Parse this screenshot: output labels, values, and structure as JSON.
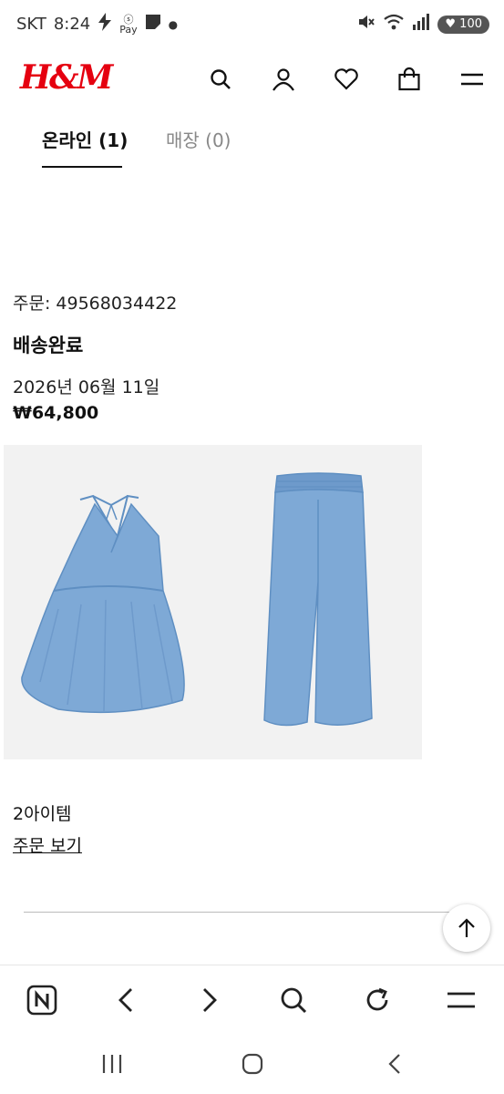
{
  "status_bar": {
    "carrier": "SKT",
    "time": "8:24",
    "battery": "100"
  },
  "header": {
    "logo": "H&M",
    "brand_color": "#e50010",
    "icons": [
      "search-icon",
      "account-icon",
      "heart-icon",
      "bag-icon",
      "menu-icon"
    ]
  },
  "tabs": [
    {
      "label": "온라인 (1)",
      "active": true
    },
    {
      "label": "매장 (0)",
      "active": false
    }
  ],
  "order": {
    "number_text": "주문: 49568034422",
    "status": "배송완료",
    "date": "2026년 06월 11일",
    "price": "₩64,800",
    "item_count": "2아이템",
    "view_order_label": "주문 보기"
  },
  "product_colors": {
    "denim": "#7ea9d6",
    "denim_dark": "#5f8fc2",
    "background": "#f2f2f2"
  },
  "browser_toolbar": {
    "icons": [
      "naver-n-icon",
      "back-icon",
      "forward-icon",
      "search-icon",
      "refresh-icon",
      "menu-icon"
    ]
  },
  "system_nav": {
    "icons": [
      "recent-apps-icon",
      "home-icon",
      "back-icon"
    ]
  }
}
